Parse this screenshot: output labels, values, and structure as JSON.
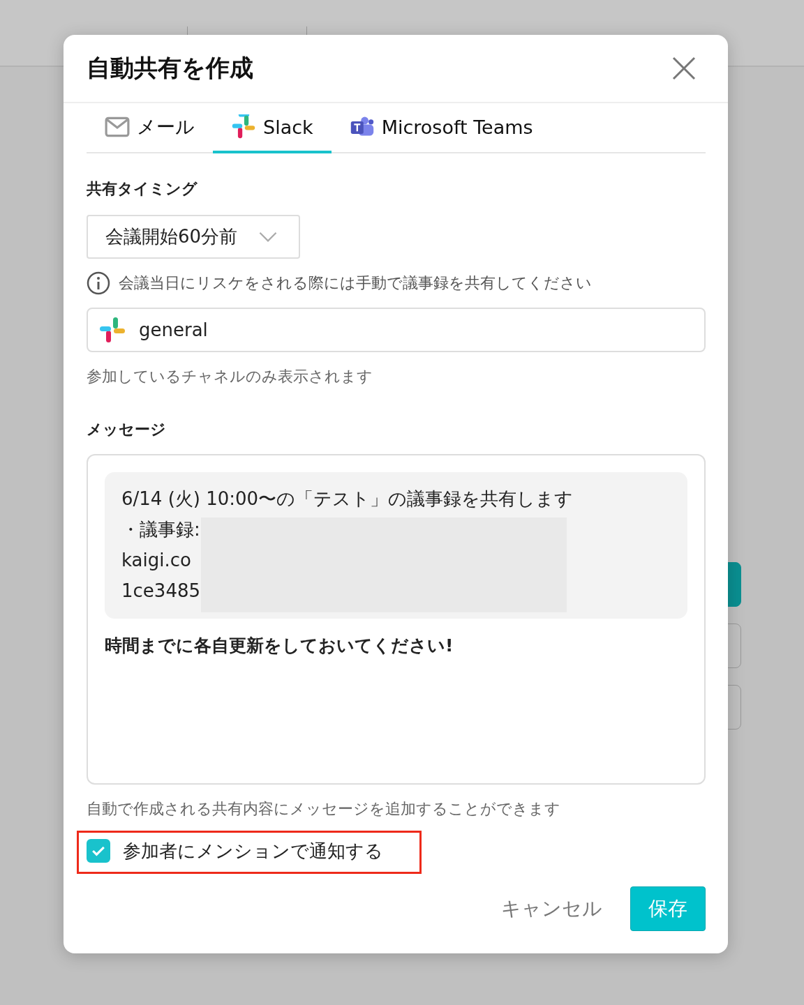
{
  "dialog": {
    "title": "自動共有を作成",
    "tabs": [
      {
        "label": "メール",
        "kind": "mail",
        "selected": false
      },
      {
        "label": "Slack",
        "kind": "slack",
        "selected": true
      },
      {
        "label": "Microsoft Teams",
        "kind": "teams",
        "selected": false
      }
    ],
    "timing": {
      "label": "共有タイミング",
      "value": "会議開始60分前",
      "note": "会議当日にリスケをされる際には手動で議事録を共有してください"
    },
    "channel": {
      "value": "general",
      "hint": "参加しているチャネルのみ表示されます"
    },
    "message": {
      "label": "メッセージ",
      "preview_lines": [
        "6/14 (火) 10:00〜の「テスト」の議事録を共有します",
        "・議事録:",
        "kaigi.co",
        "1ce3485"
      ],
      "redacted": true,
      "text": "時間までに各自更新をしておいてください!",
      "hint": "自動で作成される共有内容にメッセージを追加することができます"
    },
    "mention": {
      "label": "参加者にメンションで通知する",
      "checked": true,
      "highlighted": true
    },
    "buttons": {
      "cancel": "キャンセル",
      "save": "保存"
    }
  }
}
